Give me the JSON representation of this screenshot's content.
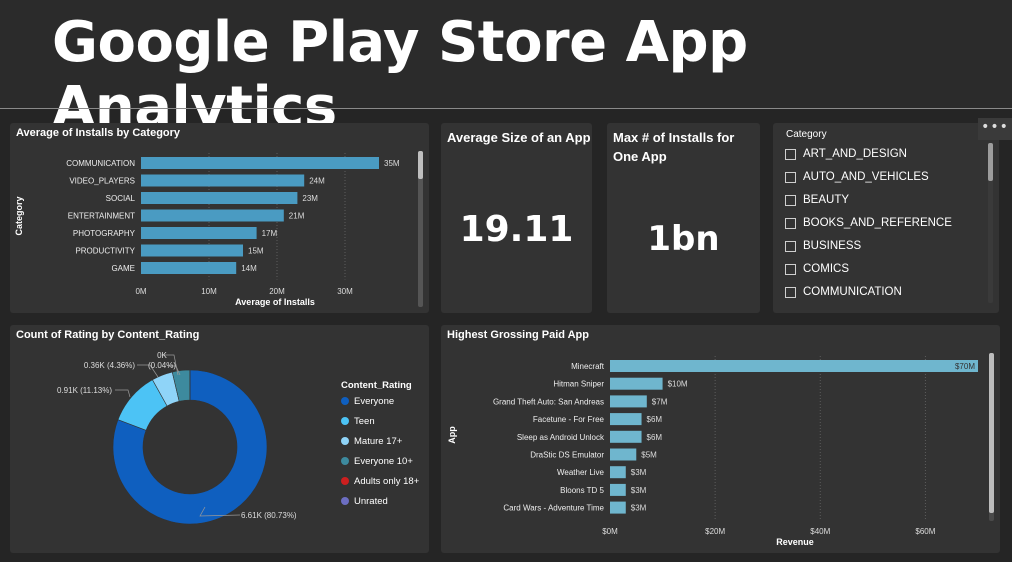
{
  "dashboard": {
    "title": "Google Play Store App Analytics",
    "more_options": "•••"
  },
  "kpis": {
    "avg_size": {
      "title": "Average Size of an App",
      "value": "19.11"
    },
    "max_installs": {
      "title_line1": "Max # of Installs for",
      "title_line2": "One App",
      "value": "1bn"
    }
  },
  "slicer": {
    "title": "Category",
    "items": [
      "ART_AND_DESIGN",
      "AUTO_AND_VEHICLES",
      "BEAUTY",
      "BOOKS_AND_REFERENCE",
      "BUSINESS",
      "COMICS",
      "COMMUNICATION"
    ]
  },
  "colors": {
    "bar_installs": "#4a9bc2",
    "bar_revenue": "#6fb6ce",
    "card_bg": "#333333"
  },
  "chart_data": [
    {
      "type": "bar",
      "orientation": "horizontal",
      "title": "Average of Installs by Category",
      "xlabel": "Average of Installs",
      "ylabel": "Category",
      "categories": [
        "COMMUNICATION",
        "VIDEO_PLAYERS",
        "SOCIAL",
        "ENTERTAINMENT",
        "PHOTOGRAPHY",
        "PRODUCTIVITY",
        "GAME"
      ],
      "values": [
        35,
        24,
        23,
        21,
        17,
        15,
        14
      ],
      "data_labels": [
        "35M",
        "24M",
        "23M",
        "21M",
        "17M",
        "15M",
        "14M"
      ],
      "x_ticks": [
        "0M",
        "10M",
        "20M",
        "30M"
      ],
      "xlim": [
        0,
        35
      ],
      "units": "M"
    },
    {
      "type": "pie",
      "donut": true,
      "title": "Count of Rating by Content_Rating",
      "legend_title": "Content_Rating",
      "legend_position": "right",
      "slices": [
        {
          "name": "Everyone",
          "value": 6.61,
          "color": "#0f5fbf",
          "label": "6.61K (80.73%)"
        },
        {
          "name": "Teen",
          "value": 0.91,
          "color": "#4cc3f5",
          "label": "0.91K (11.13%)"
        },
        {
          "name": "Mature 17+",
          "value": 0.36,
          "color": "#8fd4f8",
          "label": "0.36K (4.36%)"
        },
        {
          "name": "Everyone 10+",
          "value": 0.3,
          "color": "#3d8a9e",
          "label": ""
        },
        {
          "name": "Adults only 18+",
          "value": 0.0,
          "color": "#cc1f1f",
          "label": "0K"
        },
        {
          "name": "Unrated",
          "value": 0.003,
          "color": "#6c6ec2",
          "label": "(0.04%)"
        }
      ]
    },
    {
      "type": "bar",
      "orientation": "horizontal",
      "title": "Highest Grossing Paid App",
      "xlabel": "Revenue",
      "ylabel": "App",
      "categories": [
        "Minecraft",
        "Hitman Sniper",
        "Grand Theft Auto: San Andreas",
        "Facetune - For Free",
        "Sleep as Android Unlock",
        "DraStic DS Emulator",
        "Weather Live",
        "Bloons TD 5",
        "Card Wars - Adventure Time"
      ],
      "values": [
        70,
        10,
        7,
        6,
        6,
        5,
        3,
        3,
        3
      ],
      "data_labels": [
        "$70M",
        "$10M",
        "$7M",
        "$6M",
        "$6M",
        "$5M",
        "$3M",
        "$3M",
        "$3M"
      ],
      "x_ticks": [
        "$0M",
        "$20M",
        "$40M",
        "$60M"
      ],
      "xlim": [
        0,
        70
      ],
      "units": "$M"
    }
  ]
}
